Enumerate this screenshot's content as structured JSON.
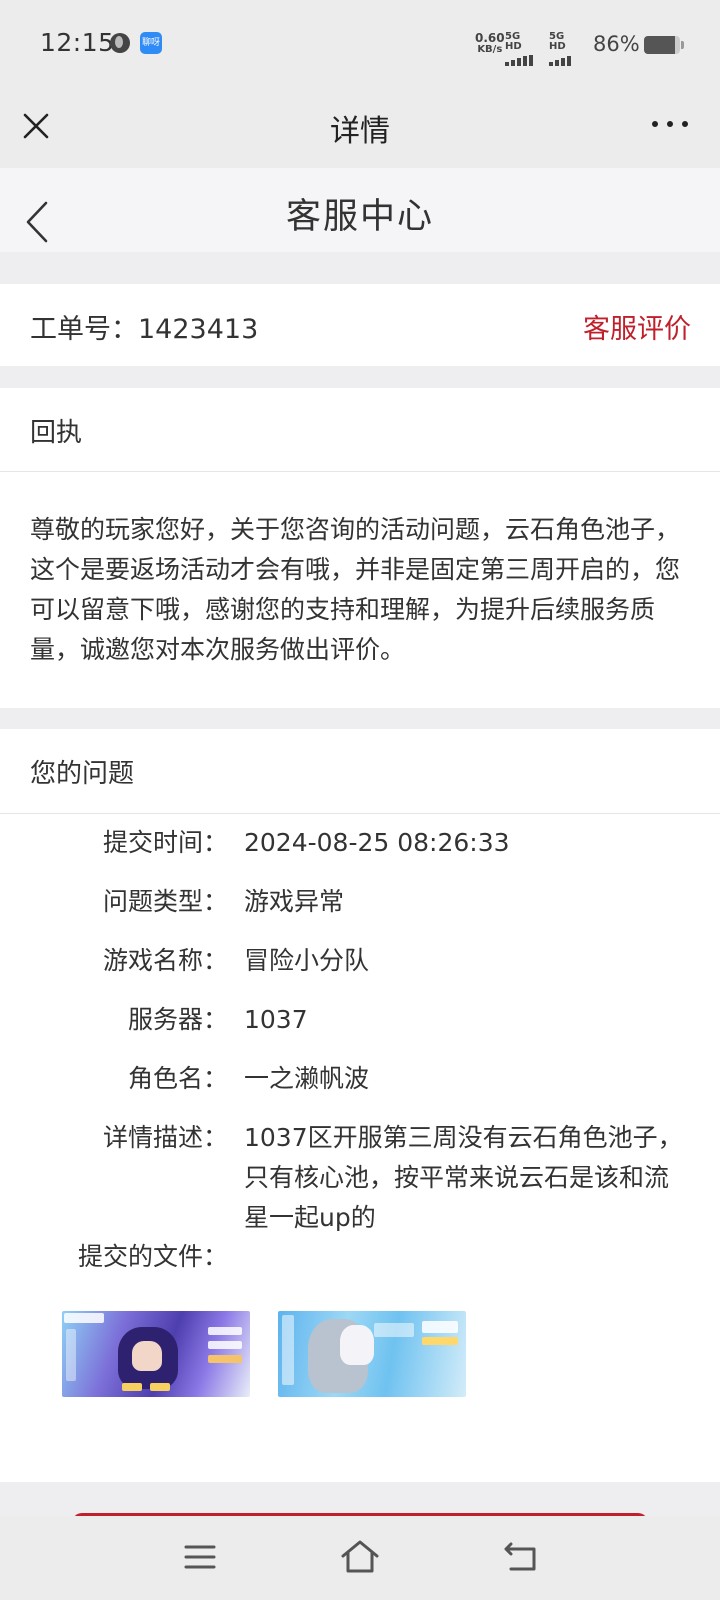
{
  "status_bar": {
    "time": "12:15",
    "app_badge": "聊呀",
    "net_speed_value": "0.60",
    "net_speed_unit": "KB/s",
    "sim1_label": "5G HD",
    "sim2_label": "5G HD",
    "battery_text": "86%",
    "battery_level": 0.86
  },
  "top_bar": {
    "title": "详情",
    "close_icon": "close-icon",
    "more_icon": "more-icon"
  },
  "page_header": {
    "title": "客服中心",
    "back_icon": "chevron-left-icon"
  },
  "ticket": {
    "label": "工单号：1423413",
    "rate_link": "客服评价",
    "accent_color": "#c0202c"
  },
  "reply": {
    "title": "回执",
    "text": "尊敬的玩家您好，关于您咨询的活动问题，云石角色池子，这个是要返场活动才会有哦，并非是固定第三周开启的，您可以留意下哦，感谢您的支持和理解，为提升后续服务质量，诚邀您对本次服务做出评价。"
  },
  "question": {
    "title": "您的问题",
    "fields": [
      {
        "label": "提交时间：",
        "value": "2024-08-25 08:26:33"
      },
      {
        "label": "问题类型：",
        "value": "游戏异常"
      },
      {
        "label": "游戏名称：",
        "value": "冒险小分队"
      },
      {
        "label": "服务器：",
        "value": "1037"
      },
      {
        "label": "角色名：",
        "value": "一之濑帆波"
      },
      {
        "label": "详情描述：",
        "value": "1037区开服第三周没有云石角色池子，只有核心池，按平常来说云石是该和流星一起up的"
      }
    ],
    "files_label": "提交的文件：",
    "attachments": [
      "screenshot-thumbnail",
      "screenshot-thumbnail"
    ]
  },
  "nav_bar": {
    "icons": [
      "menu-icon",
      "home-icon",
      "back-icon"
    ]
  }
}
